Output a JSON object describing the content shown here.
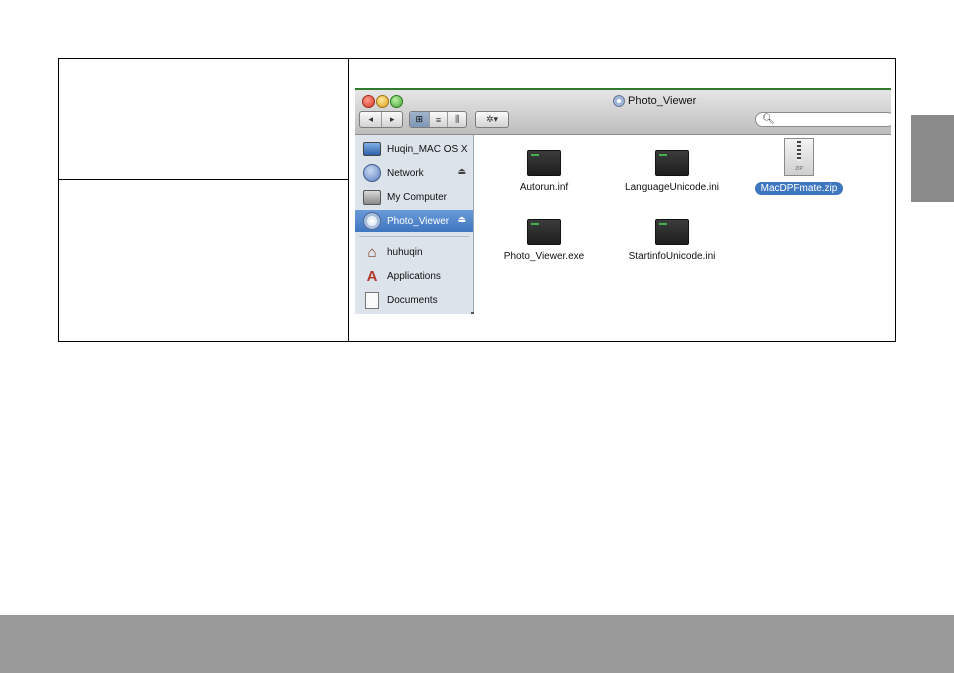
{
  "finder": {
    "window_title": "Photo_Viewer",
    "toolbar": {
      "back_glyph": "◂",
      "forward_glyph": "▸",
      "view_icon_glyph": "⊞",
      "view_list_glyph": "≡",
      "view_column_glyph": "⫼",
      "action_glyph": "✲▾"
    },
    "search": {
      "placeholder": ""
    },
    "sidebar": {
      "items": [
        {
          "label": "Huqin_MAC OS X",
          "icon": "monitor-icon"
        },
        {
          "label": "Network",
          "icon": "globe-icon",
          "eject": "⏏"
        },
        {
          "label": "My Computer",
          "icon": "drive-icon"
        },
        {
          "label": "Photo_Viewer",
          "icon": "disc-icon",
          "eject": "⏏",
          "selected": true
        },
        {
          "label": "huhuqin",
          "icon": "home-icon"
        },
        {
          "label": "Applications",
          "icon": "applications-icon"
        },
        {
          "label": "Documents",
          "icon": "document-icon"
        }
      ]
    },
    "files": [
      {
        "name": "Autorun.inf",
        "icon": "executable-file-icon"
      },
      {
        "name": "LanguageUnicode.ini",
        "icon": "executable-file-icon"
      },
      {
        "name": "MacDPFmate.zip",
        "icon": "zip-file-icon",
        "selected": true,
        "badge": "ZIP"
      },
      {
        "name": "Photo_Viewer.exe",
        "icon": "executable-file-icon"
      },
      {
        "name": "StartinfoUnicode.ini",
        "icon": "executable-file-icon"
      }
    ]
  },
  "colors": {
    "selection": "#3f76c0",
    "sidebar_bg": "#dde3eb",
    "side_tab": "#8a8a8a",
    "footer_bar": "#9a9a9a"
  }
}
